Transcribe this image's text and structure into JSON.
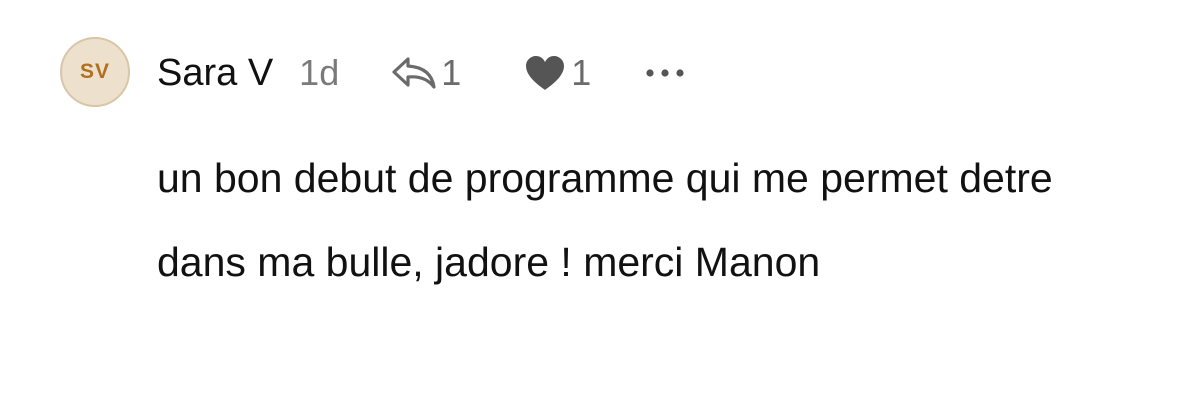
{
  "comment": {
    "avatar_initials": "SV",
    "author": "Sara V",
    "time": "1d",
    "reply_count": "1",
    "like_count": "1",
    "text": "un bon debut de programme qui me permet detre dans ma bulle, jadore ! merci Manon"
  },
  "colors": {
    "avatar_bg": "#ede0cc",
    "avatar_text": "#b0701e",
    "muted": "#6b6b6b"
  },
  "icons": {
    "reply": "reply-arrow-icon",
    "like": "heart-icon",
    "more": "more-dots-icon"
  }
}
